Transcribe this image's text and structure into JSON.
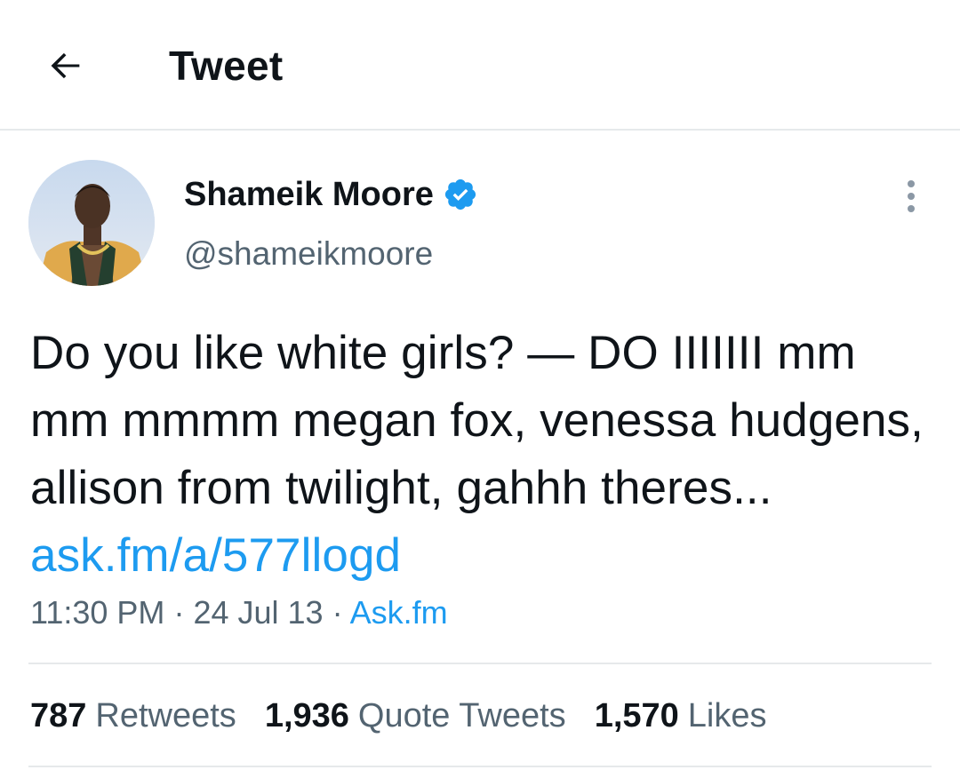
{
  "header": {
    "title": "Tweet",
    "back_icon": "arrow-left-icon"
  },
  "author": {
    "name": "Shameik Moore",
    "handle": "@shameikmoore",
    "verified": true,
    "verified_color": "#1d9bf0"
  },
  "tweet": {
    "text": "Do you like white girls? — DO IIIIIII mm mm mmmm megan fox, venessa hudgens, allison from twilight, gahhh theres...",
    "link_text": "ask.fm/a/577llogd",
    "time": "11:30 PM",
    "date": "24 Jul 13",
    "source": "Ask.fm",
    "separator": "·"
  },
  "stats": {
    "retweets_count": "787",
    "retweets_label": "Retweets",
    "quotes_count": "1,936",
    "quotes_label": "Quote Tweets",
    "likes_count": "1,570",
    "likes_label": "Likes"
  },
  "colors": {
    "link": "#1d9bf0",
    "text": "#0f1419",
    "secondary": "#536471",
    "divider": "#e6e9eb"
  }
}
